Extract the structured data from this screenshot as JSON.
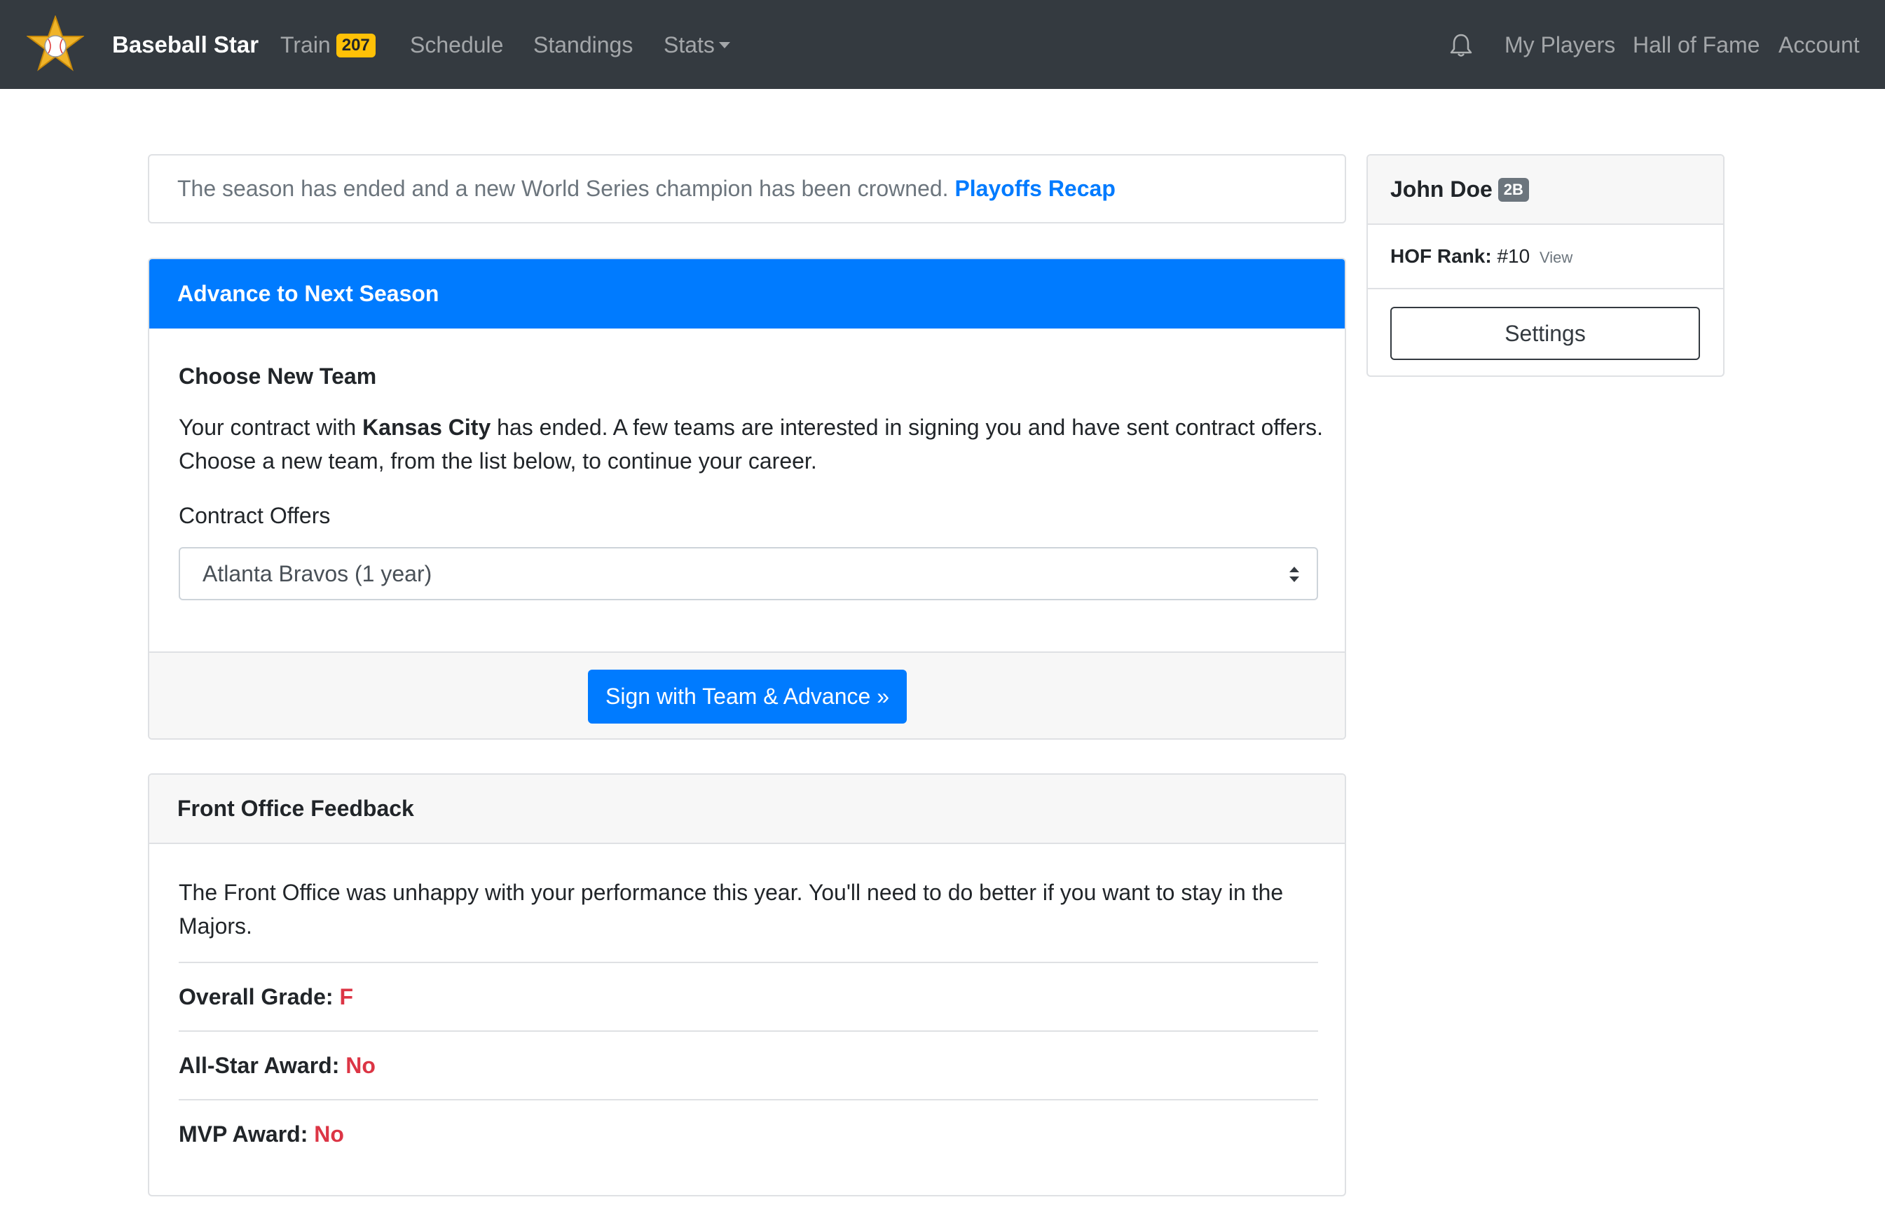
{
  "navbar": {
    "brand": "Baseball Star",
    "train_label": "Train",
    "train_count": "207",
    "schedule": "Schedule",
    "standings": "Standings",
    "stats": "Stats",
    "my_players": "My Players",
    "hall_of_fame": "Hall of Fame",
    "account": "Account"
  },
  "alert": {
    "text": "The season has ended and a new World Series champion has been crowned.",
    "link": "Playoffs Recap"
  },
  "advance": {
    "header": "Advance to Next Season",
    "section_title": "Choose New Team",
    "text_before": "Your contract with",
    "team": "Kansas City",
    "text_after": "has ended. A few teams are interested in signing you and have sent contract offers. Choose a new team, from the list below, to continue your career.",
    "offers_label": "Contract Offers",
    "selected_offer": "Atlanta Bravos (1 year)",
    "button": "Sign with Team & Advance »"
  },
  "feedback": {
    "header": "Front Office Feedback",
    "text": "The Front Office was unhappy with your performance this year. You'll need to do better if you want to stay in the Majors.",
    "rows": [
      {
        "label": "Overall Grade:",
        "value": "F"
      },
      {
        "label": "All-Star Award:",
        "value": "No"
      },
      {
        "label": "MVP Award:",
        "value": "No"
      }
    ]
  },
  "player": {
    "name": "John Doe",
    "position": "2B",
    "hof_label": "HOF Rank:",
    "hof_value": "#10",
    "hof_view": "View",
    "settings": "Settings"
  },
  "colors": {
    "navbar": "#343a40",
    "primary": "#007bff",
    "badge_yellow": "#ffc107",
    "danger": "#dc3545"
  },
  "icons": [
    "baseball-star-logo-icon",
    "bell-icon",
    "select-arrows-icon",
    "caret-down-icon"
  ]
}
